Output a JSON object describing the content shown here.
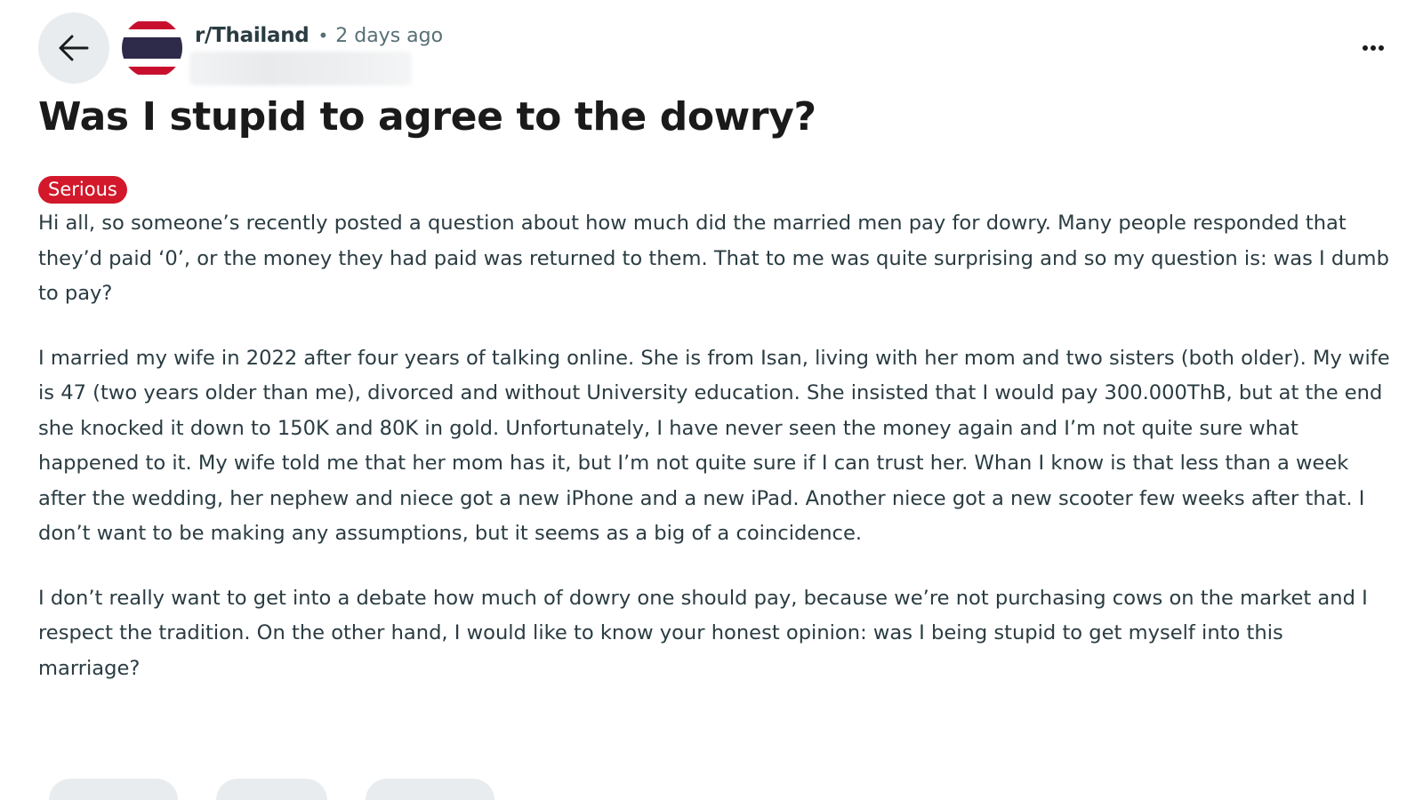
{
  "header": {
    "subreddit": "r/Thailand",
    "separator": "•",
    "timestamp": "2 days ago"
  },
  "post": {
    "title": "Was I stupid to agree to the dowry?",
    "flair": "Serious",
    "flair_color": "#d2182a",
    "paragraphs": [
      "Hi all, so someone’s recently posted a question about how much did the married men pay for dowry. Many people responded that they’d paid ‘0’, or the money they had paid was returned to them. That to me was quite surprising and so my question is: was I dumb to pay?",
      "I married my wife in 2022 after four years of talking online. She is from Isan, living with her mom and two sisters (both older). My wife is 47 (two years older than me), divorced and without University education. She insisted that I would pay 300.000ThB, but at the end she knocked it down to 150K and 80K in gold. Unfortunately, I have never seen the money again and I’m not quite sure what happened to it. My wife told me that her mom has it, but I’m not quite sure if I can trust her. Whan I know is that less than a week after the wedding, her nephew and niece got a new iPhone and a new iPad. Another niece got a new scooter few weeks after that. I don’t want to be making any assumptions, but it seems as a big of a coincidence.",
      "I don’t really want to get into a debate how much of dowry one should pay, because we’re not purchasing cows on the market and I respect the tradition. On the other hand, I would like to know your honest opinion: was I being stupid to get myself into this marriage?"
    ]
  },
  "icons": {
    "back": "arrow-left-icon",
    "avatar": "thailand-flag-icon",
    "more": "more-horizontal-icon"
  }
}
